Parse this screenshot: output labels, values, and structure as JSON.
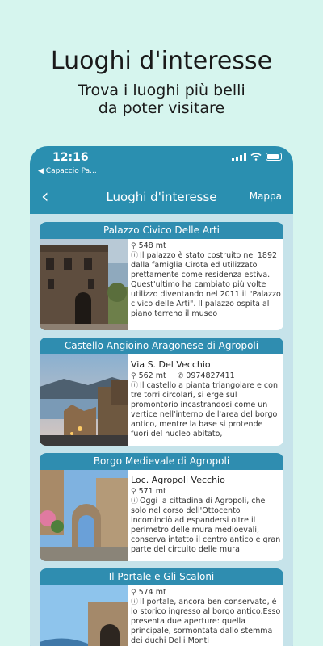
{
  "promo": {
    "title": "Luoghi d'interesse",
    "subtitle_line1": "Trova i luoghi più belli",
    "subtitle_line2": "da poter visitare"
  },
  "status": {
    "time": "12:16",
    "back_app": "◀ Capaccio Pa..."
  },
  "nav": {
    "back_icon": "‹",
    "title": "Luoghi d'interesse",
    "map_label": "Mappa"
  },
  "places": [
    {
      "name": "Palazzo Civico Delle Arti",
      "address": "",
      "distance": "548 mt",
      "phone": "",
      "description": "Il palazzo è stato costruito nel 1892 dalla famiglia Cirota ed utilizzato prettamente come residenza estiva. Quest'ultimo ha cambiato più volte utilizzo diventando nel 2011 il \"Palazzo civico delle Arti\". Il palazzo ospita al piano terreno il museo"
    },
    {
      "name": "Castello Angioino Aragonese di Agropoli",
      "address": "Via S. Del Vecchio",
      "distance": "562 mt",
      "phone": "0974827411",
      "description": "Il castello a pianta triangolare e con tre torri circolari, si erge sul promontorio incastrandosi come un vertice nell'interno dell'area del borgo antico, mentre la base si protende fuori del nucleo abitato,"
    },
    {
      "name": "Borgo Medievale di Agropoli",
      "address": "Loc. Agropoli Vecchio",
      "distance": "571 mt",
      "phone": "",
      "description": "Oggi la cittadina di Agropoli, che solo nel corso dell'Ottocento incominciò ad espandersi oltre il perimetro delle mura medioevali, conserva intatto il centro antico e gran parte del circuito delle mura"
    },
    {
      "name": "Il Portale e Gli Scaloni",
      "address": "",
      "distance": "574 mt",
      "phone": "",
      "description": "Il portale, ancora ben conservato, è lo storico ingresso al borgo antico.Esso presenta due aperture: quella principale, sormontata dallo stemma dei duchi Delli Monti"
    }
  ]
}
